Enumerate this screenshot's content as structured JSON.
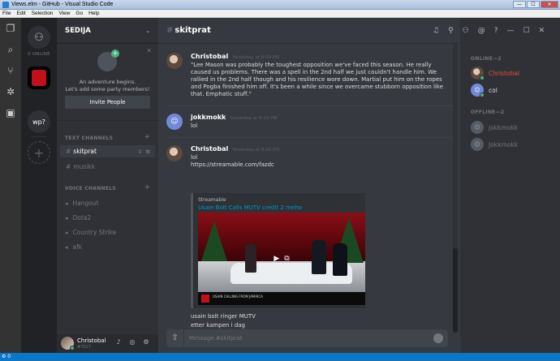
{
  "window": {
    "title": "Views.elm - GitHub - Visual Studio Code",
    "buttons": {
      "minimize": "—",
      "maximize": "☐",
      "close": "✕"
    }
  },
  "menubar": [
    "File",
    "Edit",
    "Selection",
    "View",
    "Go",
    "Help"
  ],
  "statusbar": {
    "item": "⚙ 0"
  },
  "guilds": {
    "online_count": "0 ONLINE",
    "wp_label": "wp?",
    "add_label": "+"
  },
  "server": {
    "name": "SEDIJA",
    "invite": {
      "line1": "An adventure begins.",
      "line2": "Let's add some party members!",
      "button": "Invite People"
    },
    "text_category": "TEXT CHANNELS",
    "text_channels": [
      "skitprat",
      "musikk"
    ],
    "voice_category": "VOICE CHANNELS",
    "voice_channels": [
      "Hangout",
      "Dota2",
      "Country Strike",
      "afk"
    ]
  },
  "user": {
    "name": "Christobal",
    "discriminator": "#7017"
  },
  "chat": {
    "channel": "skitprat",
    "messages": [
      {
        "author": "Christobal",
        "time": "Yesterday at 6:04 PM",
        "text": "\"Lee Mason was probably the toughest opposition we've faced this season. He really caused us problems. There was a spell in the 2nd half we just couldn't handle him. We rallied in the 2nd half though and his resilience wore down. Martial put him on the ropes and Pogba finished him off. It's been a while since we overcame stubborn opposition like that. Emphatic stuff.\""
      },
      {
        "author": "jokkmokk",
        "time": "Yesterday at 6:14 PM",
        "text": "lol"
      },
      {
        "author": "Christobal",
        "time": "Yesterday at 8:10 PM",
        "text": "lol",
        "link": "https://streamable.com/fazdc",
        "embed": {
          "provider": "Streamable",
          "title": "Usain Bolt Calls MUTV credit 2 meho",
          "caption": "USAIN\nCALLING FROM JAMAICA"
        },
        "after": [
          "usain bolt ringer MUTV",
          "etter kampen i dag"
        ]
      }
    ],
    "composer_placeholder": "Message #skitprat"
  },
  "members": {
    "online_header": "ONLINE—2",
    "online": [
      {
        "name": "Christobal",
        "color": "#e74c3c"
      },
      {
        "name": "col",
        "color": "#dcddde"
      }
    ],
    "offline_header": "OFFLINE—2",
    "offline": [
      {
        "name": "jokkmokk"
      },
      {
        "name": "Jokkmokk"
      }
    ]
  },
  "colors": {
    "accent": "#7289da",
    "link": "#0096cf",
    "online": "#43b581",
    "statusbar": "#0b77c6"
  }
}
